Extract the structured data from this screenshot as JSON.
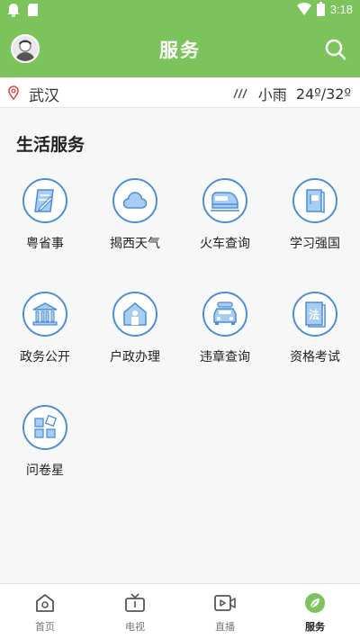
{
  "status_bar": {
    "time": "3:18"
  },
  "header": {
    "title": "服务"
  },
  "location": {
    "city": "武汉",
    "weather_condition": "小雨",
    "temperature": "24º/32º"
  },
  "section": {
    "title": "生活服务"
  },
  "services": [
    {
      "label": "粤省事",
      "icon": "document-pen-icon"
    },
    {
      "label": "揭西天气",
      "icon": "cloud-icon"
    },
    {
      "label": "火车查询",
      "icon": "train-icon"
    },
    {
      "label": "学习强国",
      "icon": "book-flag-icon"
    },
    {
      "label": "政务公开",
      "icon": "government-building-icon"
    },
    {
      "label": "户政办理",
      "icon": "house-person-icon"
    },
    {
      "label": "违章查询",
      "icon": "car-icon"
    },
    {
      "label": "资格考试",
      "icon": "law-book-icon"
    },
    {
      "label": "问卷星",
      "icon": "grid-app-icon"
    }
  ],
  "tabs": [
    {
      "label": "首页",
      "icon": "home-icon",
      "active": false
    },
    {
      "label": "电视",
      "icon": "tv-icon",
      "active": false
    },
    {
      "label": "直播",
      "icon": "video-icon",
      "active": false
    },
    {
      "label": "服务",
      "icon": "leaf-icon",
      "active": true
    }
  ],
  "colors": {
    "brand": "#7cc35b",
    "icon_stroke": "#4a8fd8",
    "icon_fill": "#a9cdf2"
  }
}
